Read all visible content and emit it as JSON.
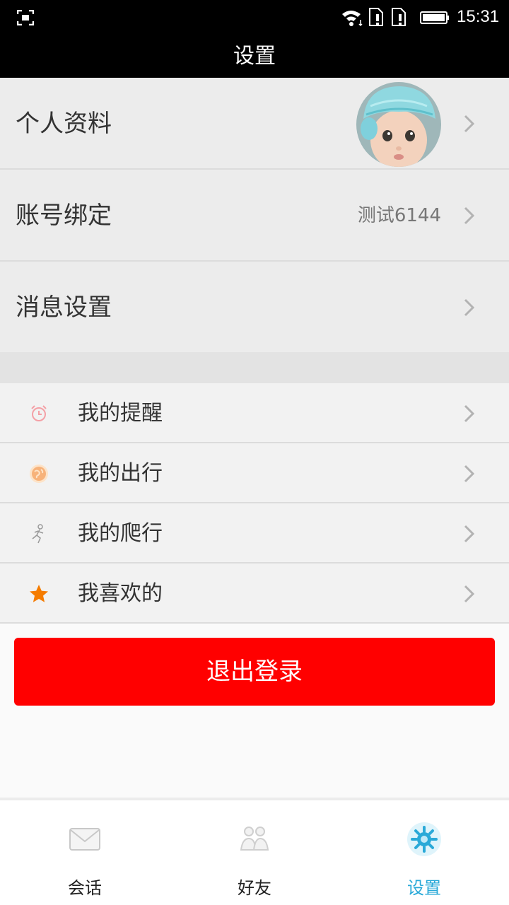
{
  "status_bar": {
    "time": "15:31"
  },
  "header": {
    "title": "设置"
  },
  "profile_section": {
    "personal_info_label": "个人资料",
    "account_binding_label": "账号绑定",
    "account_binding_value": "测试6144",
    "message_settings_label": "消息设置"
  },
  "features": [
    {
      "label": "我的提醒",
      "icon": "alarm-clock-icon"
    },
    {
      "label": "我的出行",
      "icon": "globe-icon"
    },
    {
      "label": "我的爬行",
      "icon": "runner-icon"
    },
    {
      "label": "我喜欢的",
      "icon": "star-icon"
    }
  ],
  "logout_label": "退出登录",
  "tabs": [
    {
      "label": "会话",
      "icon": "envelope-icon"
    },
    {
      "label": "好友",
      "icon": "friends-icon"
    },
    {
      "label": "设置",
      "icon": "gear-icon",
      "active": true
    }
  ],
  "colors": {
    "logout_button": "#ff0000",
    "active_tab": "#29a9d8",
    "header_bg": "#000000"
  }
}
